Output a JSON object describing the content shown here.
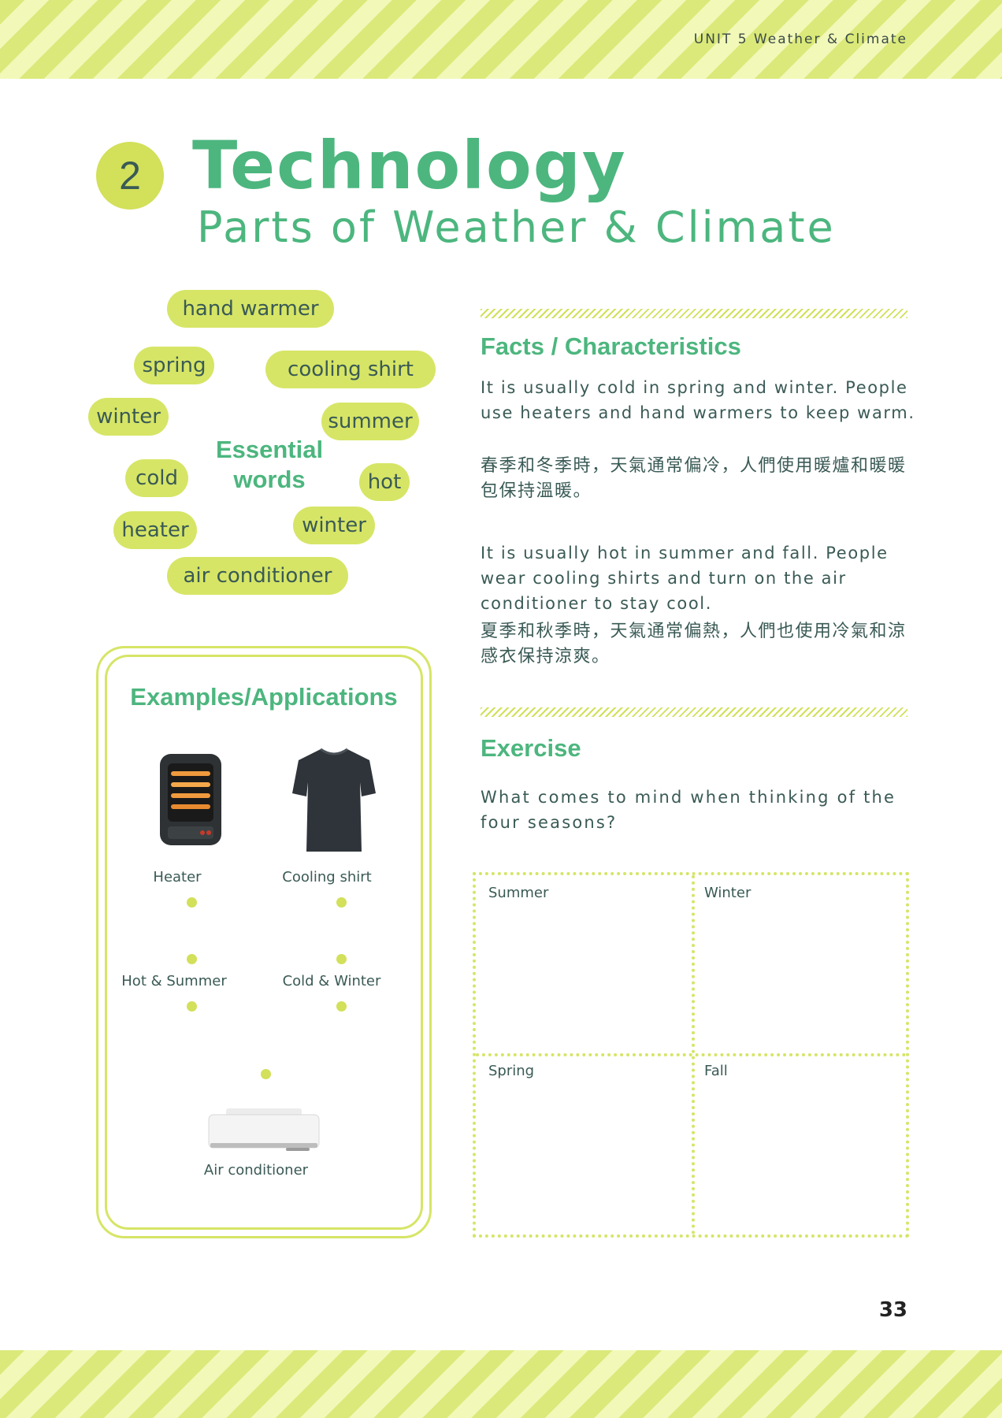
{
  "header": {
    "unit": "UNIT 5  Weather & Climate"
  },
  "lesson": {
    "number": "2",
    "title": "Technology",
    "subtitle": "Parts of Weather & Climate"
  },
  "essential_words": {
    "heading_line1": "Essential",
    "heading_line2": "words",
    "words": [
      "hand warmer",
      "spring",
      "cooling shirt",
      "winter",
      "summer",
      "cold",
      "hot",
      "heater",
      "winter",
      "air conditioner"
    ]
  },
  "examples": {
    "title": "Examples/Applications",
    "items": [
      {
        "label": "Heater",
        "icon": "heater-icon"
      },
      {
        "label": "Cooling shirt",
        "icon": "shirt-icon"
      },
      {
        "label": "Air conditioner",
        "icon": "air-conditioner-icon"
      }
    ],
    "matches": [
      "Hot & Summer",
      "Cold & Winter"
    ]
  },
  "facts": {
    "heading": "Facts / Characteristics",
    "p1_en": "It is usually cold in spring and winter. People use heaters and hand warmers to keep warm.",
    "p1_zh": "春季和冬季時，天氣通常偏冷，人們使用暖爐和暖暖包保持溫暖。",
    "p2_en": "It is usually hot in summer and fall. People wear cooling shirts and turn on the air conditioner to stay cool.",
    "p2_zh": "夏季和秋季時，天氣通常偏熱，人們也使用冷氣和涼感衣保持涼爽。"
  },
  "exercise": {
    "heading": "Exercise",
    "question": "What comes to mind when thinking of the four seasons?",
    "boxes": [
      "Summer",
      "Winter",
      "Spring",
      "Fall"
    ]
  },
  "page_number": "33",
  "colors": {
    "accent_green": "#4cb67e",
    "lime": "#d6e566",
    "text": "#3a5a55"
  }
}
